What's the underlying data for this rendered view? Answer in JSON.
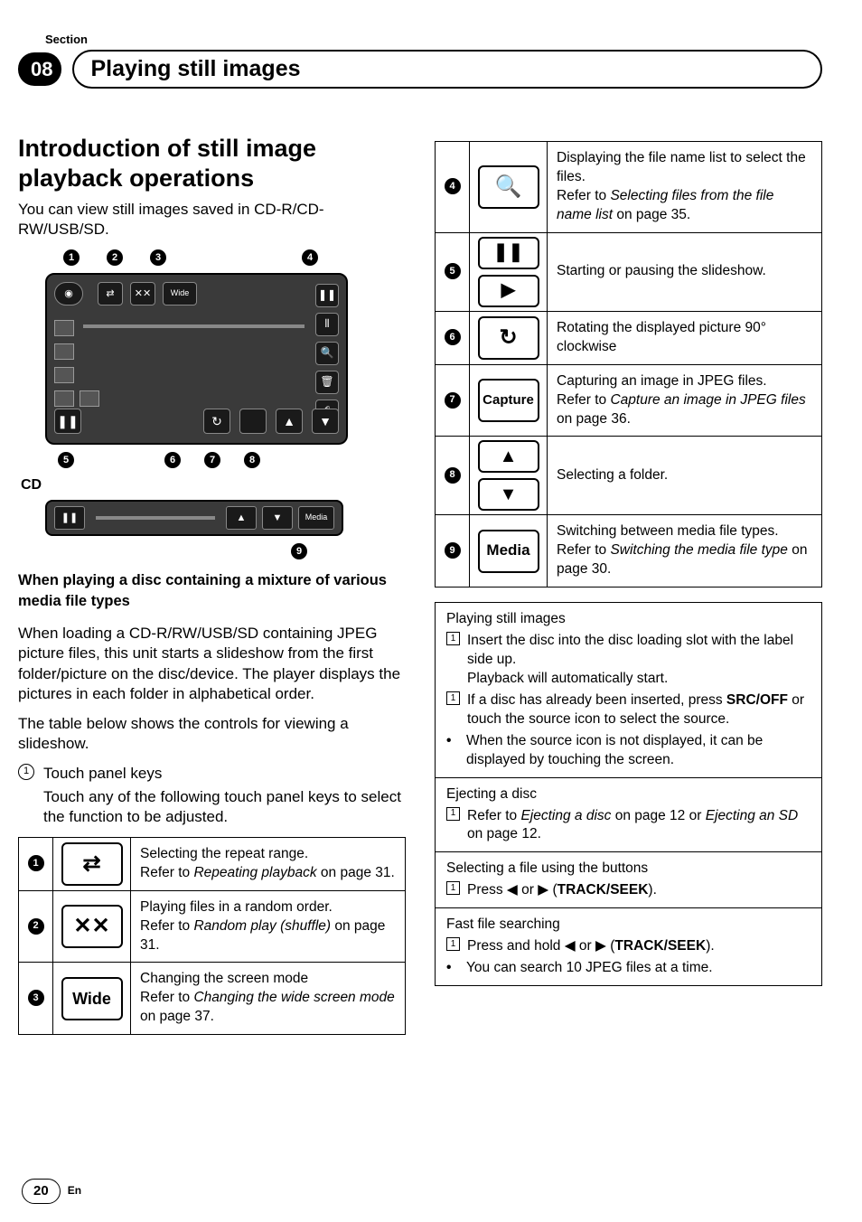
{
  "header": {
    "section_label": "Section",
    "chapter_num": "08",
    "chapter_title": "Playing still images"
  },
  "left": {
    "intro_heading": "Introduction of still image playback operations",
    "intro_text": "You can view still images saved in CD-R/CD-RW/USB/SD.",
    "callouts_top": [
      "1",
      "2",
      "3",
      "4"
    ],
    "callouts_bottom": [
      "5",
      "6",
      "7",
      "8"
    ],
    "cd_label": "CD",
    "callout_9": "9",
    "mix_heading": "When playing a disc containing a mixture of various media file types",
    "mix_text": "When loading a CD-R/RW/USB/SD containing JPEG picture files, this unit starts a slideshow from the first folder/picture on the disc/device. The player displays the pictures in each folder in alphabetical order.",
    "table_intro": "The table below shows the controls for viewing a slideshow.",
    "step1_num": "1",
    "step1_label": "Touch panel keys",
    "step1_text": "Touch any of the following touch panel keys to select the function to be adjusted.",
    "diag": {
      "wide": "Wide",
      "media": "Media"
    }
  },
  "keys_left": [
    {
      "n": "1",
      "icon": "⇄",
      "desc_a": "Selecting the repeat range.",
      "desc_b": "Refer to ",
      "desc_i": "Repeating playback",
      "desc_c": " on page 31."
    },
    {
      "n": "2",
      "icon": "✕✕",
      "desc_a": "Playing files in a random order.",
      "desc_b": "Refer to ",
      "desc_i": "Random play (shuffle)",
      "desc_c": " on page 31."
    },
    {
      "n": "3",
      "icon": "Wide",
      "icon_text": true,
      "desc_a": "Changing the screen mode",
      "desc_b": "Refer to ",
      "desc_i": "Changing the wide screen mode",
      "desc_c": " on page 37."
    }
  ],
  "keys_right": [
    {
      "n": "4",
      "icon": "🔍",
      "desc_a": "Displaying the file name list to select the files.",
      "desc_b": "Refer to ",
      "desc_i": "Selecting files from the file name list",
      "desc_c": " on page 35."
    },
    {
      "n": "5",
      "stack": [
        "❚❚",
        "▶"
      ],
      "desc_a": "Starting or pausing the slideshow."
    },
    {
      "n": "6",
      "icon": "↻",
      "desc_a": "Rotating the displayed picture 90° clockwise"
    },
    {
      "n": "7",
      "icon": "Capture",
      "icon_text": true,
      "desc_a": "Capturing an image in JPEG files.",
      "desc_b": "Refer to ",
      "desc_i": "Capture an image in JPEG files",
      "desc_c": " on page 36."
    },
    {
      "n": "8",
      "stack": [
        "▲",
        "▼"
      ],
      "desc_a": "Selecting a folder."
    },
    {
      "n": "9",
      "icon": "Media",
      "icon_text": true,
      "desc_a": "Switching between media file types.",
      "desc_b": "Refer to ",
      "desc_i": "Switching the media file type",
      "desc_c": " on page 30."
    }
  ],
  "proc": {
    "s1_title": "Playing still images",
    "s1_l1": "Insert the disc into the disc loading slot with the label side up.",
    "s1_l1b": "Playback will automatically start.",
    "s1_l2a": "If a disc has already been inserted, press ",
    "s1_l2b": "SRC/OFF",
    "s1_l2c": " or touch the source icon to select the source.",
    "s1_l3": "When the source icon is not displayed, it can be displayed by touching the screen.",
    "s2_title": "Ejecting a disc",
    "s2_l1a": "Refer to ",
    "s2_l1i1": "Ejecting a disc",
    "s2_l1b": " on page 12 or ",
    "s2_l1i2": "Ejecting an SD",
    "s2_l1c": " on page 12.",
    "s3_title": "Selecting a file using the buttons",
    "s3_l1a": "Press ◀ or ▶ (",
    "s3_l1b": "TRACK/SEEK",
    "s3_l1c": ").",
    "s4_title": "Fast file searching",
    "s4_l1a": "Press and hold ◀ or ▶ (",
    "s4_l1b": "TRACK/SEEK",
    "s4_l1c": ").",
    "s4_l2": "You can search 10 JPEG files at a time."
  },
  "footer": {
    "page": "20",
    "lang": "En"
  }
}
